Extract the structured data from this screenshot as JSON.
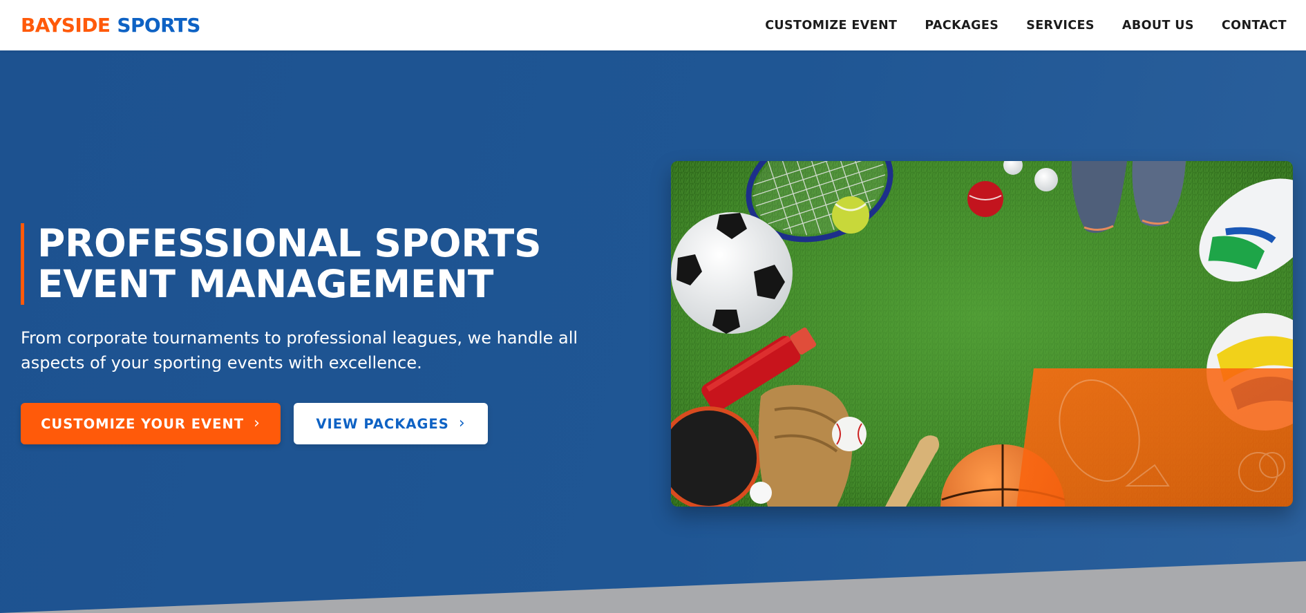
{
  "brand": {
    "part1": "BAYSIDE",
    "part2": "SPORTS"
  },
  "nav": {
    "items": [
      {
        "label": "CUSTOMIZE EVENT"
      },
      {
        "label": "PACKAGES"
      },
      {
        "label": "SERVICES"
      },
      {
        "label": "ABOUT US"
      },
      {
        "label": "CONTACT"
      }
    ]
  },
  "hero": {
    "title_line1": "PROFESSIONAL SPORTS",
    "title_line2": "EVENT MANAGEMENT",
    "subtitle": "From corporate tournaments to professional leagues, we handle all aspects of your sporting events with excellence.",
    "primary_button": "CUSTOMIZE YOUR EVENT",
    "secondary_button": "VIEW PACKAGES",
    "chevron_icon": "chevron-right-icon",
    "image_icon": "sports-equipment-image"
  },
  "colors": {
    "accent_orange": "#ff5a0a",
    "brand_blue": "#0e62c4",
    "hero_blue": "#1e5592",
    "slant_gray": "#a9aaad"
  }
}
